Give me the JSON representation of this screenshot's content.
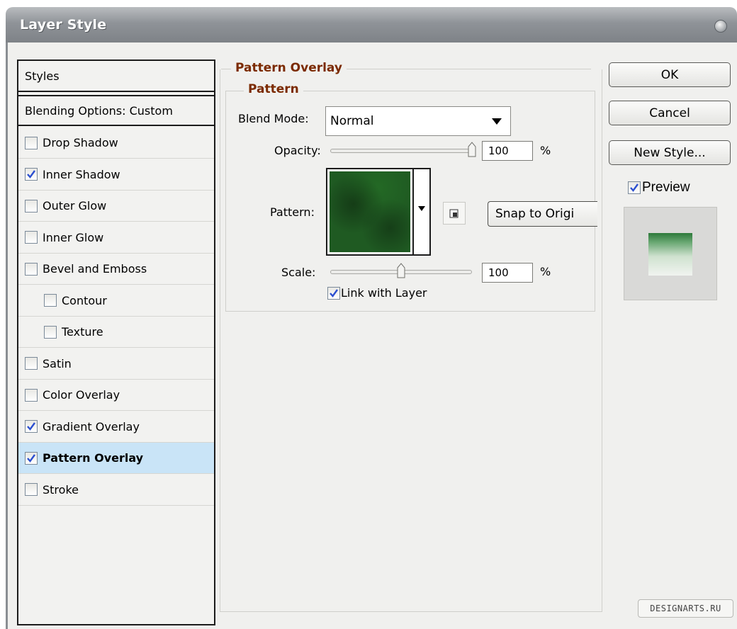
{
  "window": {
    "title": "Layer Style"
  },
  "styles_panel": {
    "header": "Styles",
    "blending": "Blending Options: Custom",
    "items": [
      {
        "label": "Drop Shadow",
        "checked": false,
        "indent": false,
        "selected": false
      },
      {
        "label": "Inner Shadow",
        "checked": true,
        "indent": false,
        "selected": false
      },
      {
        "label": "Outer Glow",
        "checked": false,
        "indent": false,
        "selected": false
      },
      {
        "label": "Inner Glow",
        "checked": false,
        "indent": false,
        "selected": false
      },
      {
        "label": "Bevel and Emboss",
        "checked": false,
        "indent": false,
        "selected": false
      },
      {
        "label": "Contour",
        "checked": false,
        "indent": true,
        "selected": false
      },
      {
        "label": "Texture",
        "checked": false,
        "indent": true,
        "selected": false
      },
      {
        "label": "Satin",
        "checked": false,
        "indent": false,
        "selected": false
      },
      {
        "label": "Color Overlay",
        "checked": false,
        "indent": false,
        "selected": false
      },
      {
        "label": "Gradient Overlay",
        "checked": true,
        "indent": false,
        "selected": false
      },
      {
        "label": "Pattern Overlay",
        "checked": true,
        "indent": false,
        "selected": true
      },
      {
        "label": "Stroke",
        "checked": false,
        "indent": false,
        "selected": false
      }
    ]
  },
  "pattern_overlay": {
    "section_title": "Pattern Overlay",
    "group_title": "Pattern",
    "blend_mode_label": "Blend Mode:",
    "blend_mode_value": "Normal",
    "opacity_label": "Opacity:",
    "opacity_value": "100",
    "opacity_unit": "%",
    "opacity_level": 1.0,
    "pattern_label": "Pattern:",
    "snap_button": "Snap to Origi",
    "scale_label": "Scale:",
    "scale_value": "100",
    "scale_unit": "%",
    "scale_level": 0.5,
    "link_label": "Link with Layer",
    "link_checked": true
  },
  "buttons": {
    "ok": "OK",
    "cancel": "Cancel",
    "new_style": "New Style...",
    "preview_label": "Preview",
    "preview_checked": true
  },
  "watermark": "DESIGNARTS.RU",
  "colors": {
    "accent_title": "#7b2a00",
    "selection": "#c9e4f7",
    "check": "#2b4fd0"
  }
}
